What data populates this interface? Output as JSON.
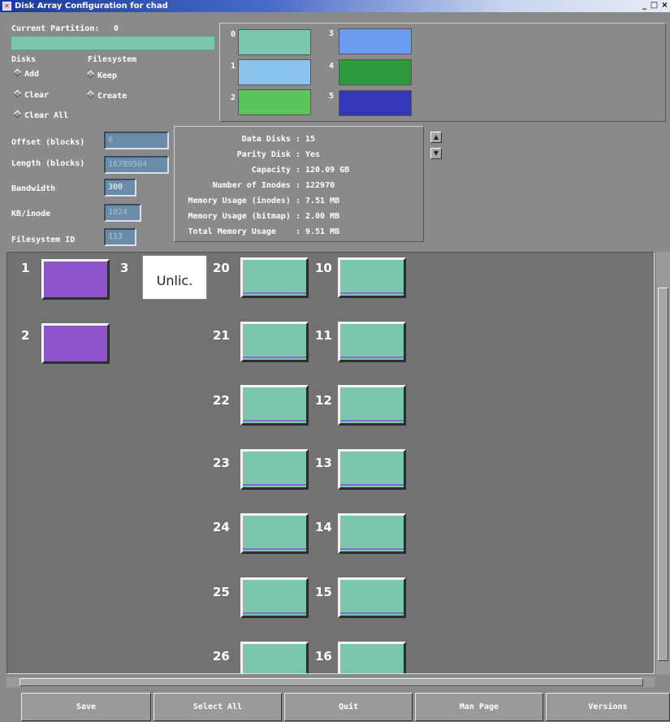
{
  "window": {
    "title": "Disk Array Configuration for chad",
    "controls": [
      "_",
      "□",
      "×"
    ]
  },
  "partition": {
    "label": "Current Partition:",
    "value": "0"
  },
  "disks_section": {
    "heading": "Disks",
    "options": [
      "Add",
      "Clear",
      "Clear All"
    ]
  },
  "filesystem_section": {
    "heading": "Filesystem",
    "options": [
      "Keep",
      "Create"
    ]
  },
  "legend": [
    {
      "num": "0",
      "color": "#7bc6ac"
    },
    {
      "num": "1",
      "color": "#8cc4ee"
    },
    {
      "num": "2",
      "color": "#5cc45c"
    },
    {
      "num": "3",
      "color": "#6a9cf0"
    },
    {
      "num": "4",
      "color": "#2e9a3e"
    },
    {
      "num": "5",
      "color": "#3438b8"
    }
  ],
  "fields": [
    {
      "label": "Offset (blocks)",
      "value": "0"
    },
    {
      "label": "Length (blocks)",
      "value": "16789504"
    },
    {
      "label": "Bandwidth",
      "value": "300"
    },
    {
      "label": "KB/inode",
      "value": "1024"
    },
    {
      "label": "Filesystem ID",
      "value": "113"
    }
  ],
  "stats": [
    {
      "label": "Data Disks :",
      "value": "15"
    },
    {
      "label": "Parity Disk :",
      "value": "Yes"
    },
    {
      "label": "Capacity :",
      "value": "120.09 GB"
    },
    {
      "label": "Number of Inodes :",
      "value": "122970"
    },
    {
      "label": "Memory Usage (inodes) :",
      "value": "7.51 MB"
    },
    {
      "label": "Memory Usage (bitmap) :",
      "value": "2.00 MB"
    },
    {
      "label": "Total Memory Usage    :",
      "value": "9.51 MB"
    }
  ],
  "disks": {
    "purple": [
      "1",
      "2"
    ],
    "unlicensed": {
      "num": "3",
      "text": "Unlic."
    },
    "col_a": [
      "20",
      "21",
      "22",
      "23",
      "24",
      "25",
      "26"
    ],
    "col_b": [
      "10",
      "11",
      "12",
      "13",
      "14",
      "15",
      "16"
    ]
  },
  "buttons": [
    "Save",
    "Select All",
    "Quit",
    "Man Page",
    "Versions"
  ]
}
